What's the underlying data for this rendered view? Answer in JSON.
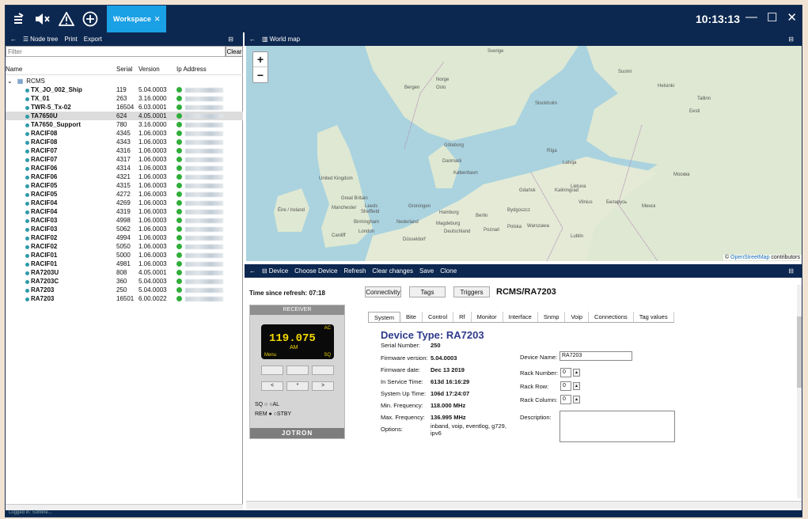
{
  "topbar": {
    "tab": "Workspace",
    "clock": "10:13:13"
  },
  "left": {
    "back": "←",
    "node_tree": "Node tree",
    "print": "Print",
    "export": "Export",
    "filter_placeholder": "Filter",
    "clear": "Clear",
    "cols": {
      "name": "Name",
      "serial": "Serial",
      "version": "Version",
      "ip": "Ip Address"
    },
    "root": "RCMS",
    "rows": [
      {
        "name": "TX_JO_002_Ship",
        "serial": "119",
        "version": "5.04.0003"
      },
      {
        "name": "TX_01",
        "serial": "263",
        "version": "3.16.0000"
      },
      {
        "name": "TWR-5_Tx-02",
        "serial": "16504",
        "version": "6.03.0001"
      },
      {
        "name": "TA7650U",
        "serial": "624",
        "version": "4.05.0001"
      },
      {
        "name": "TA7650_Support",
        "serial": "780",
        "version": "3.16.0000"
      },
      {
        "name": "RACIF08",
        "serial": "4345",
        "version": "1.06.0003"
      },
      {
        "name": "RACIF08",
        "serial": "4343",
        "version": "1.06.0003"
      },
      {
        "name": "RACIF07",
        "serial": "4316",
        "version": "1.06.0003"
      },
      {
        "name": "RACIF07",
        "serial": "4317",
        "version": "1.06.0003"
      },
      {
        "name": "RACIF06",
        "serial": "4314",
        "version": "1.06.0003"
      },
      {
        "name": "RACIF06",
        "serial": "4321",
        "version": "1.06.0003"
      },
      {
        "name": "RACIF05",
        "serial": "4315",
        "version": "1.06.0003"
      },
      {
        "name": "RACIF05",
        "serial": "4272",
        "version": "1.06.0003"
      },
      {
        "name": "RACIF04",
        "serial": "4269",
        "version": "1.06.0003"
      },
      {
        "name": "RACIF04",
        "serial": "4319",
        "version": "1.06.0003"
      },
      {
        "name": "RACIF03",
        "serial": "4998",
        "version": "1.06.0003"
      },
      {
        "name": "RACIF03",
        "serial": "5062",
        "version": "1.06.0003"
      },
      {
        "name": "RACIF02",
        "serial": "4994",
        "version": "1.06.0003"
      },
      {
        "name": "RACIF02",
        "serial": "5050",
        "version": "1.06.0003"
      },
      {
        "name": "RACIF01",
        "serial": "5000",
        "version": "1.06.0003"
      },
      {
        "name": "RACIF01",
        "serial": "4981",
        "version": "1.06.0003"
      },
      {
        "name": "RA7203U",
        "serial": "808",
        "version": "4.05.0001"
      },
      {
        "name": "RA7203C",
        "serial": "360",
        "version": "5.04.0003"
      },
      {
        "name": "RA7203",
        "serial": "250",
        "version": "5.04.0003"
      },
      {
        "name": "RA7203",
        "serial": "16501",
        "version": "6.00.0022"
      }
    ]
  },
  "map": {
    "title": "World map",
    "attrib_pre": "© ",
    "attrib_link": "OpenStreetMap",
    "attrib_post": " contributors",
    "labels": [
      "Sverige",
      "Norge",
      "Suomi",
      "Helsinki",
      "Tallinn",
      "Eesti",
      "Oslo",
      "Stockholm",
      "Bergen",
      "Danmark",
      "København",
      "United Kingdom",
      "Éire / Ireland",
      "Great Britain",
      "Manchester",
      "Leeds",
      "Birmingham",
      "London",
      "Nederland",
      "Hamburg",
      "Deutschland",
      "Berlin",
      "Polska",
      "Warszawa",
      "Latvija",
      "Lietuva",
      "Беларусь",
      "Минск",
      "Москва",
      "Rīga",
      "Göteborg",
      "Groningen",
      "Gdańsk",
      "Kaliningrad",
      "Vilnius",
      "Düsseldorf",
      "Lublin",
      "Cardiff",
      "Sheffield",
      "Bydgoszcz",
      "Poznań",
      "Magdeburg"
    ]
  },
  "device": {
    "menu": [
      "Device",
      "Choose Device",
      "Refresh",
      "Clear changes",
      "Save",
      "Clone"
    ],
    "refresh_lbl": "Time since refresh:",
    "refresh_val": "07:18",
    "buttons": {
      "connectivity": "Connectivity",
      "tags": "Tags",
      "triggers": "Triggers"
    },
    "path": "RCMS/RA7203",
    "receiver": {
      "title": "RECEIVER",
      "freq": "119.075",
      "mode": "AM",
      "ac": "AC",
      "menu": "Menu",
      "sq": "SQ",
      "btn_left": "<",
      "btn_mid": "*",
      "btn_right": ">",
      "ind1": "SQ ○ ○AL",
      "ind2": "REM ● ○STBY",
      "brand": "JOTRON"
    },
    "tabs": [
      "System",
      "Bite",
      "Control",
      "Rf",
      "Monitor",
      "Interface",
      "Snmp",
      "Voip",
      "Connections",
      "Tag values"
    ],
    "type": "Device Type: RA7203",
    "fields": [
      {
        "l": "Serial Number:",
        "v": "250"
      },
      {
        "l": "Firmware version:",
        "v": "5.04.0003"
      },
      {
        "l": "Firmware date:",
        "v": "Dec 13 2019"
      },
      {
        "l": "In Service Time:",
        "v": "613d 16:16:29"
      },
      {
        "l": "System Up Time:",
        "v": "106d 17:24:07"
      },
      {
        "l": "Min. Frequency:",
        "v": "118.000 MHz"
      },
      {
        "l": "Max. Frequency:",
        "v": "136.995 MHz"
      },
      {
        "l": "Options:",
        "v": "inband, voip, eventlog, g729, ipv6"
      }
    ],
    "device_name_lbl": "Device Name:",
    "device_name": "RA7203",
    "rack_number_lbl": "Rack Number:",
    "rack_number": "0",
    "rack_row_lbl": "Rack Row:",
    "rack_row": "0",
    "rack_col_lbl": "Rack Column:",
    "rack_col": "0",
    "desc_lbl": "Description:"
  },
  "status": "Logged in: Softline..."
}
